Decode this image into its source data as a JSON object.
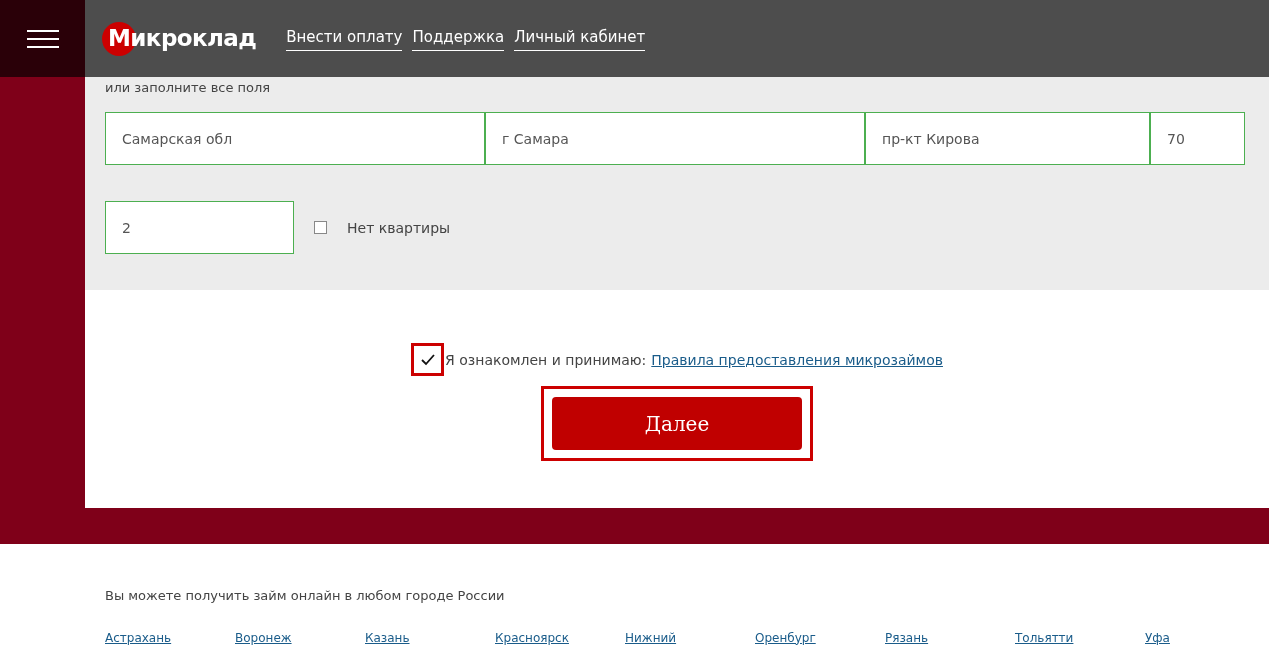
{
  "header": {
    "logo": "Микроклад",
    "nav": [
      {
        "label": "Внести оплату"
      },
      {
        "label": "Поддержка"
      },
      {
        "label": "Личный кабинет"
      }
    ]
  },
  "form": {
    "hint": "или заполните все поля",
    "fields": [
      {
        "value": "Самарская обл"
      },
      {
        "value": "г Самара"
      },
      {
        "value": "пр-кт Кирова"
      },
      {
        "value": "70"
      }
    ],
    "flat_value": "2",
    "no_flat": {
      "label": "Нет квартиры",
      "checked": false
    },
    "agreement": {
      "label": "Я ознакомлен и принимаю:",
      "link": "Правила предоставления микрозаймов",
      "checked": true
    },
    "submit": "Далее"
  },
  "footer": {
    "text": "Вы можете получить займ онлайн в любом городе России",
    "cities": [
      "Астрахань",
      "Воронеж",
      "Казань",
      "Красноярск",
      "Нижний",
      "Оренбург",
      "Рязань",
      "Тольятти",
      "Уфа"
    ]
  }
}
